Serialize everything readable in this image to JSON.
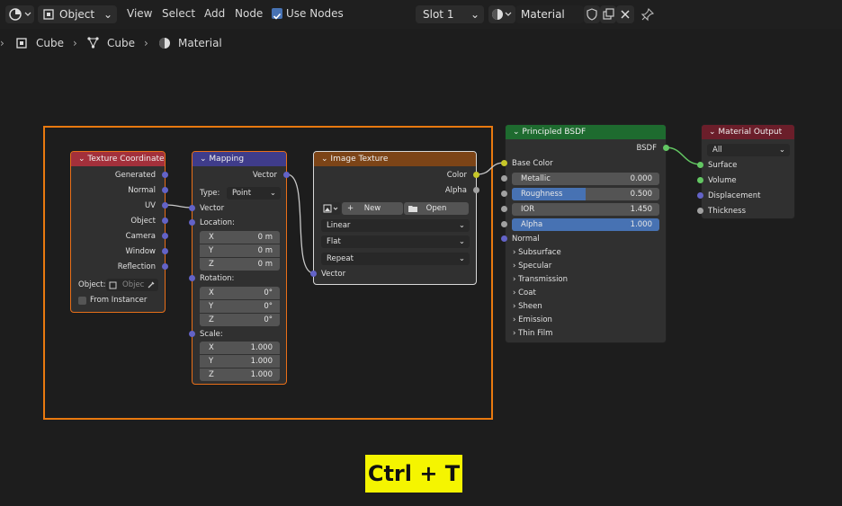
{
  "topbar": {
    "mode_label": "Object",
    "menu": [
      "View",
      "Select",
      "Add",
      "Node"
    ],
    "use_nodes_label": "Use Nodes",
    "slot_label": "Slot 1",
    "material_name": "Material"
  },
  "breadcrumb": {
    "item1": "Cube",
    "item2": "Cube",
    "item3": "Material"
  },
  "nodes": {
    "texcoord": {
      "title": "Texture Coordinate",
      "outputs": [
        "Generated",
        "Normal",
        "UV",
        "Object",
        "Camera",
        "Window",
        "Reflection"
      ],
      "object_label": "Object:",
      "object_placeholder": "Objec",
      "from_instancer": "From Instancer"
    },
    "mapping": {
      "title": "Mapping",
      "output": "Vector",
      "type_label": "Type:",
      "type_value": "Point",
      "vector": "Vector",
      "location": "Location:",
      "rotation": "Rotation:",
      "scale": "Scale:",
      "loc": [
        {
          "k": "X",
          "v": "0 m"
        },
        {
          "k": "Y",
          "v": "0 m"
        },
        {
          "k": "Z",
          "v": "0 m"
        }
      ],
      "rot": [
        {
          "k": "X",
          "v": "0°"
        },
        {
          "k": "Y",
          "v": "0°"
        },
        {
          "k": "Z",
          "v": "0°"
        }
      ],
      "scl": [
        {
          "k": "X",
          "v": "1.000"
        },
        {
          "k": "Y",
          "v": "1.000"
        },
        {
          "k": "Z",
          "v": "1.000"
        }
      ]
    },
    "image": {
      "title": "Image Texture",
      "out_color": "Color",
      "out_alpha": "Alpha",
      "new_label": "New",
      "open_label": "Open",
      "interp": "Linear",
      "proj": "Flat",
      "ext": "Repeat",
      "in_vector": "Vector"
    },
    "bsdf": {
      "title": "Principled BSDF",
      "output": "BSDF",
      "base_color": "Base Color",
      "metallic": {
        "label": "Metallic",
        "value": "0.000"
      },
      "roughness": {
        "label": "Roughness",
        "value": "0.500",
        "fill": 0.5
      },
      "ior": {
        "label": "IOR",
        "value": "1.450"
      },
      "alpha": {
        "label": "Alpha",
        "value": "1.000",
        "fill": 1.0
      },
      "normal": "Normal",
      "panels": [
        "Subsurface",
        "Specular",
        "Transmission",
        "Coat",
        "Sheen",
        "Emission",
        "Thin Film"
      ]
    },
    "output": {
      "title": "Material Output",
      "target": "All",
      "inputs": [
        "Surface",
        "Volume",
        "Displacement",
        "Thickness"
      ]
    }
  },
  "shortcut_label": "Ctrl + T",
  "colors": {
    "frame": "#e8790f",
    "texcoord_header": "#a3303b",
    "mapping_header": "#3f3c8a",
    "image_header": "#7c4417",
    "bsdf_header": "#1e6b2f",
    "output_header": "#6b1e2a",
    "vector_socket": "#6363c7",
    "color_socket": "#c7c729",
    "shader_socket": "#63c763",
    "float_socket": "#a1a1a1",
    "slider_blue": "#4772b3",
    "shortcut_bg": "#f5f500"
  }
}
